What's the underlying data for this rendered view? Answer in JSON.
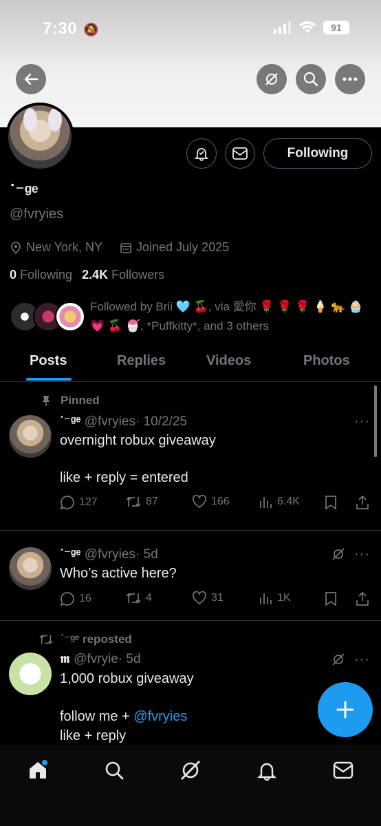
{
  "status_bar": {
    "time": "7:30",
    "battery": "91"
  },
  "profile": {
    "display_name": "꒰ᐢ.ᴗ.ᐢ꒱",
    "display_name_rendered": "ᐝ⁻ᵍᵉ",
    "handle": "@fvryies",
    "location": "New York, NY",
    "joined": "Joined July 2025",
    "following_count": "0",
    "following_label": "Following",
    "followers_count": "2.4K",
    "followers_label": "Followers",
    "follow_button": "Following",
    "followed_by": "Followed by Brii 🩵 🍒, via 愛你 🌹 🌹 🌹 🍦 🐆 🧁 💗 🍒 🍧, *Puffkitty*, and 3 others"
  },
  "tabs": [
    "Posts",
    "Replies",
    "Videos",
    "Photos"
  ],
  "posts": [
    {
      "pinned_label": "Pinned",
      "name": "ᐝ⁻ᵍᵉ",
      "handle": "@fvryies",
      "date": "· 10/2/25",
      "line1": "overnight robux giveaway",
      "line2": "like + reply = entered",
      "replies": "127",
      "reposts": "87",
      "likes": "166",
      "views": "6.4K"
    },
    {
      "name": "ᐝ⁻ᵍᵉ",
      "handle": "@fvryies",
      "date": "· 5d",
      "line1": "Who’s active here?",
      "replies": "16",
      "reposts": "4",
      "likes": "31",
      "views": "1K"
    },
    {
      "repost_label": "ᐝ⁻ᵍᵉ reposted",
      "name": "𝖒",
      "handle": "@fvryie",
      "date": "· 5d",
      "line1": "1,000 robux giveaway",
      "line2_prefix": "follow me + ",
      "line2_link": "@fvryies",
      "line3": "like + reply"
    }
  ],
  "colors": {
    "accent": "#1d9bf0",
    "muted": "#71767b",
    "text": "#e7e9ea",
    "bg": "#000000"
  }
}
